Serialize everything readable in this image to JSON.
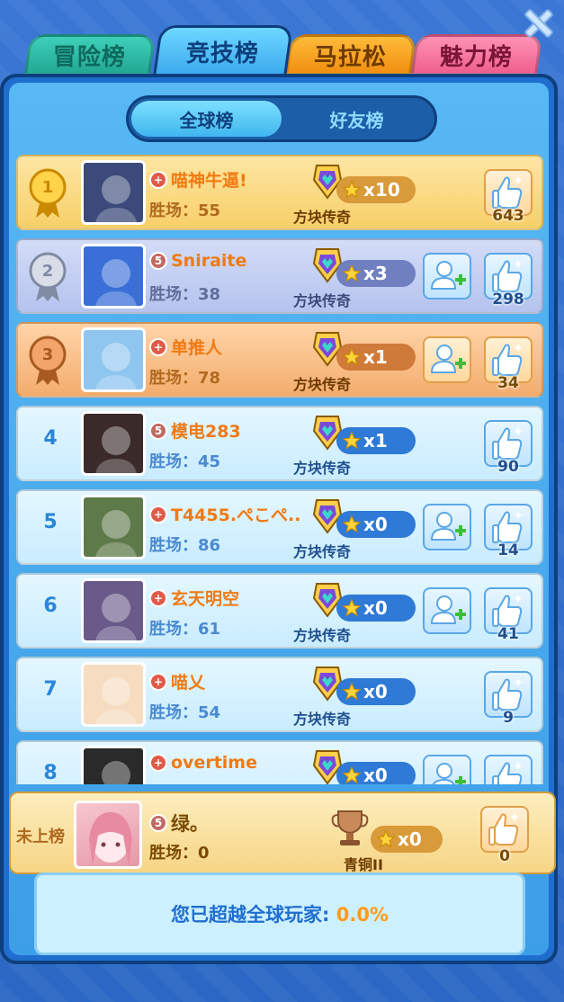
{
  "tabs": [
    {
      "label": "冒险榜",
      "active": false
    },
    {
      "label": "竞技榜",
      "active": true
    },
    {
      "label": "马拉松",
      "active": false
    },
    {
      "label": "魅力榜",
      "active": false
    }
  ],
  "sub_tabs": [
    {
      "label": "全球榜",
      "active": true
    },
    {
      "label": "好友榜",
      "active": false
    }
  ],
  "close_icon": "close-icon",
  "wins_prefix": "胜场：",
  "rows": [
    {
      "rank": "1",
      "style": "gold",
      "level_badge": "",
      "name": "喵神牛逼!",
      "wins": "55",
      "stars": "x10",
      "tier": "方块传奇",
      "likes": "643",
      "add_friend": false
    },
    {
      "rank": "2",
      "style": "silver",
      "level_badge": "5",
      "name": "Sniraite",
      "wins": "38",
      "stars": "x3",
      "tier": "方块传奇",
      "likes": "298",
      "add_friend": true
    },
    {
      "rank": "3",
      "style": "bronze",
      "level_badge": "",
      "name": "单推人",
      "wins": "78",
      "stars": "x1",
      "tier": "方块传奇",
      "likes": "34",
      "add_friend": true
    },
    {
      "rank": "4",
      "style": "normal",
      "level_badge": "5",
      "name": "模电283",
      "wins": "45",
      "stars": "x1",
      "tier": "方块传奇",
      "likes": "90",
      "add_friend": false
    },
    {
      "rank": "5",
      "style": "normal",
      "level_badge": "",
      "name": "T4455.ぺこぺ...",
      "wins": "86",
      "stars": "x0",
      "tier": "方块传奇",
      "likes": "14",
      "add_friend": true
    },
    {
      "rank": "6",
      "style": "normal",
      "level_badge": "",
      "name": "玄天明空",
      "wins": "61",
      "stars": "x0",
      "tier": "方块传奇",
      "likes": "41",
      "add_friend": true
    },
    {
      "rank": "7",
      "style": "normal",
      "level_badge": "",
      "name": "喵乂",
      "wins": "54",
      "stars": "x0",
      "tier": "方块传奇",
      "likes": "9",
      "add_friend": false
    },
    {
      "rank": "8",
      "style": "normal",
      "level_badge": "",
      "name": "overtime",
      "wins": "",
      "stars": "x0",
      "tier": "",
      "likes": "",
      "add_friend": true
    }
  ],
  "my_row": {
    "label": "未上榜",
    "level_badge": "5",
    "name": "绿。",
    "wins": "0",
    "stars": "x0",
    "tier": "青铜II",
    "likes": "0"
  },
  "footer": {
    "text": "您已超越全球玩家: ",
    "percent": "0.0%"
  },
  "colors": {
    "accent_blue": "#1f6ecf",
    "orange_name": "#f07a12",
    "gold_row": "#f7cf68",
    "silver_row": "#b5c3ee",
    "bronze_row": "#f3ad6d",
    "normal_row": "#c9ecff"
  }
}
